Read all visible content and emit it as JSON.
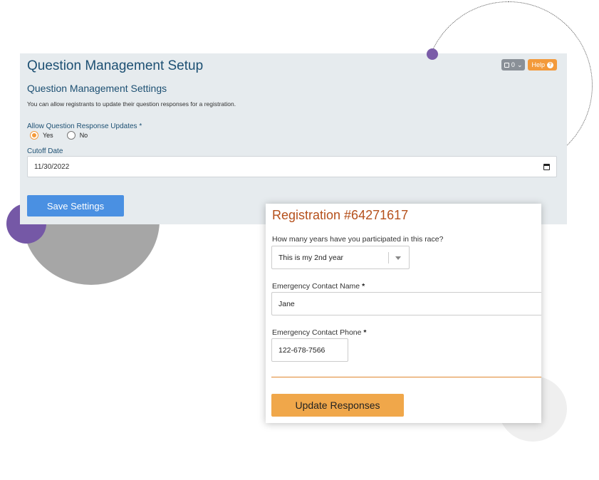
{
  "setup_panel": {
    "title": "Question Management Setup",
    "count_badge": "0",
    "help_label": "Help",
    "section_title": "Question Management Settings",
    "description": "You can allow registrants to update their question responses for a registration.",
    "allow_updates_label": "Allow Question Response Updates",
    "required_mark": "*",
    "options": [
      {
        "label": "Yes",
        "selected": true
      },
      {
        "label": "No",
        "selected": false
      }
    ],
    "cutoff_label": "Cutoff Date",
    "cutoff_value": "11/30/2022",
    "save_label": "Save Settings"
  },
  "registration_card": {
    "title": "Registration #64271617",
    "q_years": "How many years have you participated in this race?",
    "years_value": "This is my 2nd year",
    "q_contact_name": "Emergency Contact Name",
    "contact_name_value": "Jane",
    "q_contact_phone": "Emergency Contact Phone",
    "contact_phone_value": "122-678-7566",
    "required_mark": "*",
    "update_label": "Update Responses"
  },
  "colors": {
    "panel_bg": "#e6ebee",
    "heading_blue": "#1d5073",
    "primary_blue": "#4a90e2",
    "accent_orange": "#f39a3b",
    "registration_title": "#b5501b",
    "update_button": "#f0a74a",
    "decor_purple": "#7558a6",
    "decor_gray": "#a6a6a6"
  }
}
